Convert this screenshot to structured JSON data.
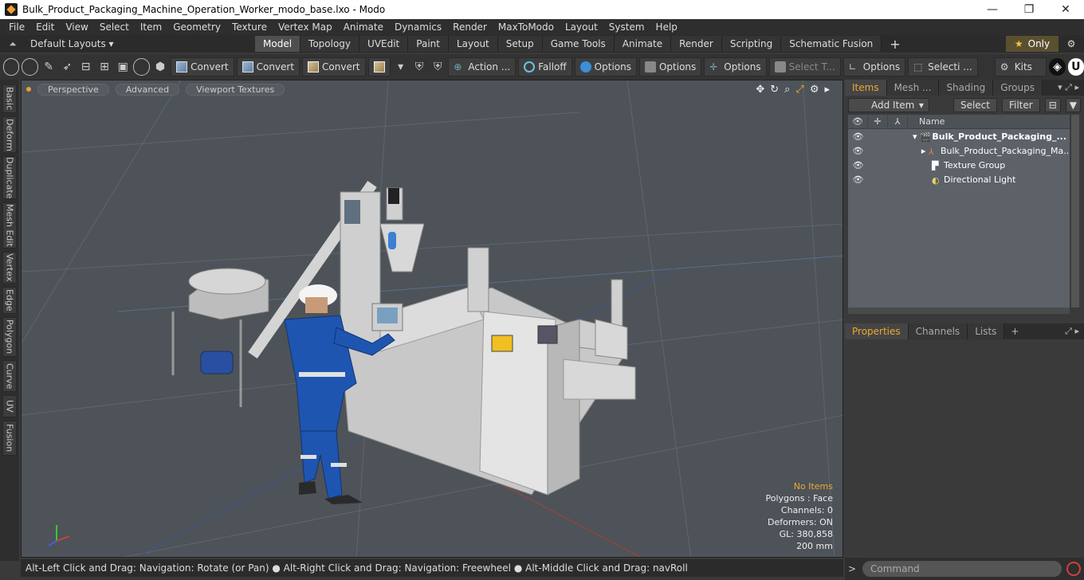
{
  "window": {
    "title": "Bulk_Product_Packaging_Machine_Operation_Worker_modo_base.lxo - Modo",
    "minimize": "—",
    "maximize": "❐",
    "close": "✕"
  },
  "menu": [
    "File",
    "Edit",
    "View",
    "Select",
    "Item",
    "Geometry",
    "Texture",
    "Vertex Map",
    "Animate",
    "Dynamics",
    "Render",
    "MaxToModo",
    "Layout",
    "System",
    "Help"
  ],
  "layouts": {
    "label": "Default Layouts ▾"
  },
  "tabs": [
    "Model",
    "Topology",
    "UVEdit",
    "Paint",
    "Layout",
    "Setup",
    "Game Tools",
    "Animate",
    "Render",
    "Scripting",
    "Schematic Fusion"
  ],
  "active_tab": "Model",
  "only_label": "Only",
  "toolbar": {
    "convert1": "Convert",
    "convert2": "Convert",
    "convert3": "Convert",
    "action": "Action ...",
    "falloff": "Falloff",
    "options1": "Options",
    "options2": "Options",
    "options3": "Options",
    "select_t": "Select T...",
    "options4": "Options",
    "selecti": "Selecti ...",
    "kits": "Kits"
  },
  "left_tabs": [
    "Basic",
    "Deform",
    "Duplicate",
    "Mesh Edit",
    "Vertex",
    "Edge",
    "Polygon",
    "Curve",
    "UV",
    "Fusion"
  ],
  "viewport": {
    "perspective": "Perspective",
    "advanced": "Advanced",
    "textures": "Viewport Textures",
    "stats": {
      "items": "No Items",
      "polygons": "Polygons : Face",
      "channels": "Channels: 0",
      "deformers": "Deformers: ON",
      "gl": "GL: 380,858",
      "scale": "200 mm"
    }
  },
  "status": "Alt-Left Click and Drag: Navigation: Rotate (or Pan) ● Alt-Right Click and Drag: Navigation: Freewheel ● Alt-Middle Click and Drag: navRoll",
  "items_panel": {
    "tabs": [
      "Items",
      "Mesh ...",
      "Shading",
      "Groups"
    ],
    "add_item": "Add Item",
    "select": "Select",
    "filter": "Filter",
    "name_header": "Name",
    "rows": [
      {
        "name": "Bulk_Product_Packaging_...",
        "bold": true,
        "icon": "scene-icon"
      },
      {
        "name": "Bulk_Product_Packaging_Ma...",
        "bold": false,
        "icon": "mesh-icon"
      },
      {
        "name": "Texture Group",
        "bold": false,
        "icon": "texture-icon"
      },
      {
        "name": "Directional Light",
        "bold": false,
        "icon": "light-icon"
      }
    ]
  },
  "props_panel": {
    "tabs": [
      "Properties",
      "Channels",
      "Lists"
    ]
  },
  "command": {
    "placeholder": "Command"
  }
}
